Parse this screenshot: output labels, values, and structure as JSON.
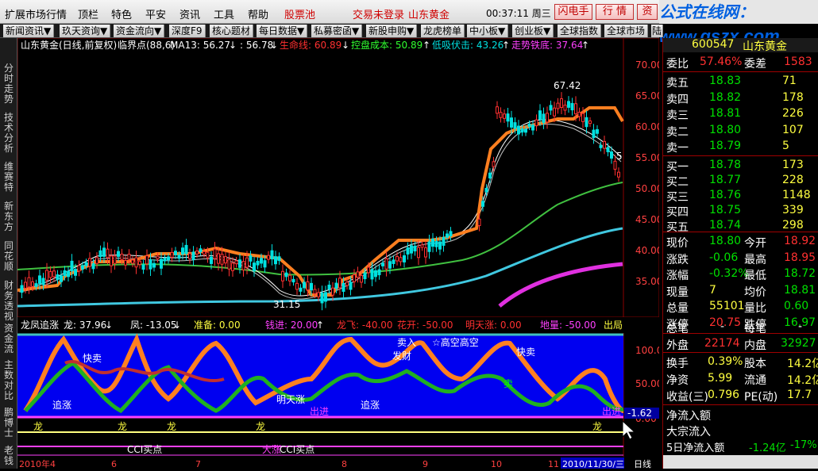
{
  "menubar": {
    "items": [
      "扩展市场行情",
      "顶栏",
      "特色",
      "平安",
      "资讯",
      "工具",
      "帮助"
    ],
    "stock_pool": "股票池",
    "login_status": "交易未登录",
    "broker": "山东黄金",
    "clock": "00:37:11 周三",
    "buttons": [
      "闪电手",
      "行 情",
      "资"
    ],
    "watermark_en": "gszx.com",
    "watermark_cn": "公式在线网：www."
  },
  "toolbar": {
    "tabs": [
      "新闻资讯▼",
      "玖天资询▼",
      "资金流向▼",
      "深度F9",
      "核心题材",
      "每日数据▼",
      "私募密函▼",
      "新股申购▼",
      "龙虎榜单",
      "中小板▼",
      "创业板▼",
      "全球指数",
      "全球市场",
      "陆"
    ]
  },
  "sidebar": {
    "items": [
      "分时走势",
      "技术分析",
      "维赛特",
      "新东方",
      "同花顺",
      "财务透视",
      "资金流",
      "主数对比",
      "鹏博士",
      "老钱"
    ]
  },
  "main_chart": {
    "header": {
      "title": "山东黄金(日线,前复权)",
      "ind1": "临界点(88,6)",
      "ma13": "MA13: 56.27",
      "arrow1": "↓",
      "ma_b": ": 56.78",
      "arrow2": "↓",
      "life_line": "生命线: 60.89",
      "arrow3": "↓",
      "control_cost": "控盘成本: 50.89",
      "arrow4": "↑",
      "low_absorb": "低吸伏击: 43.26",
      "arrow5": "↑",
      "trend_line": "走势铁底: 37.64",
      "arrow6": "↑"
    },
    "y_ticks": [
      "70.00",
      "65.00",
      "60.00",
      "55.00",
      "50.00",
      "45.00",
      "40.00",
      "35.00"
    ],
    "high_label": "67.42",
    "low_label": "31.15",
    "side_label": "5"
  },
  "sub_chart": {
    "header": {
      "name": "龙凤追涨",
      "long": "龙: 37.96",
      "long_arrow": "↓",
      "feng": "凤: -13.05",
      "feng_arrow": "↓",
      "prep": "准备: 0.00",
      "money": "钱进: 20.00",
      "money_arrow": "↑",
      "dragon_fly": "龙飞: -40.00",
      "flower": "花开: -50.00",
      "tomorrow": "明天涨: 0.00",
      "ground": "地量: -50.00",
      "exit": "出局"
    },
    "y_ticks": [
      "100.0",
      "50.00",
      "0.00"
    ],
    "cursor_value": "-1.62",
    "labels": {
      "fast_sell": "快卖",
      "chase": "追涨",
      "sell": "卖",
      "dragon": "龙",
      "tomorrow_up": "明天涨",
      "fortune": "发财",
      "raise": "大涨",
      "buy": "卖入",
      "cci_buy": "CCI买点",
      "pointer": "☆高空高空",
      "exit_label": "出进"
    }
  },
  "x_axis": {
    "labels": [
      "2010年4",
      "6",
      "7",
      "8",
      "9",
      "10",
      "11",
      "2010/11/30/三"
    ],
    "right_label": "日线"
  },
  "quote": {
    "code": "600547",
    "name": "山东黄金",
    "wei_bi_label": "委比",
    "wei_bi": "57.46%",
    "wei_cha_label": "委差",
    "wei_cha": "1583",
    "asks": [
      {
        "label": "卖五",
        "price": "18.83",
        "vol": "71"
      },
      {
        "label": "卖四",
        "price": "18.82",
        "vol": "178"
      },
      {
        "label": "卖三",
        "price": "18.81",
        "vol": "226"
      },
      {
        "label": "卖二",
        "price": "18.80",
        "vol": "107"
      },
      {
        "label": "卖一",
        "price": "18.79",
        "vol": "5"
      }
    ],
    "bids": [
      {
        "label": "买一",
        "price": "18.78",
        "vol": "173"
      },
      {
        "label": "买二",
        "price": "18.77",
        "vol": "228"
      },
      {
        "label": "买三",
        "price": "18.76",
        "vol": "1148"
      },
      {
        "label": "买四",
        "price": "18.75",
        "vol": "339"
      },
      {
        "label": "买五",
        "price": "18.74",
        "vol": "298"
      }
    ],
    "stats": [
      {
        "l1": "现价",
        "v1": "18.80",
        "c1": "green",
        "l2": "今开",
        "v2": "18.92",
        "c2": "redc"
      },
      {
        "l1": "涨跌",
        "v1": "-0.06",
        "c1": "green",
        "l2": "最高",
        "v2": "18.95",
        "c2": "redc"
      },
      {
        "l1": "涨幅",
        "v1": "-0.32%",
        "c1": "green",
        "l2": "最低",
        "v2": "18.72",
        "c2": "green"
      },
      {
        "l1": "现量",
        "v1": "7",
        "c1": "yel",
        "l2": "均价",
        "v2": "18.81",
        "c2": "green"
      },
      {
        "l1": "总量",
        "v1": "55101",
        "c1": "yel",
        "l2": "量比",
        "v2": "0.60",
        "c2": "green"
      },
      {
        "l1": "涨停",
        "v1": "20.75",
        "c1": "redc",
        "l2": "跌停",
        "v2": "16.97",
        "c2": "green"
      }
    ],
    "trades": {
      "l1": "总笔",
      "v1": "-",
      "l2": "每笔",
      "v2": "-"
    },
    "outer": {
      "l1": "外盘",
      "v1": "22174",
      "l2": "内盘",
      "v2": "32927"
    },
    "fund": [
      {
        "l1": "换手",
        "v1": "0.39%",
        "l2": "股本",
        "v2": "14.2亿"
      },
      {
        "l1": "净资",
        "v1": "5.99",
        "l2": "流通",
        "v2": "14.2亿"
      },
      {
        "l1": "收益(三)",
        "v1": "0.796",
        "l2": "PE(动)",
        "v2": "17.7"
      }
    ],
    "flow": {
      "net_in": "净流入额",
      "big_in": "大宗流入",
      "five_day": "5日净流入额",
      "five_val": "-1.24亿",
      "five_pct": "-17%"
    }
  },
  "colors": {
    "up": "#ff3030",
    "down": "#00e000",
    "blue_bg": "#0000f0",
    "orange": "#ff7f20"
  }
}
